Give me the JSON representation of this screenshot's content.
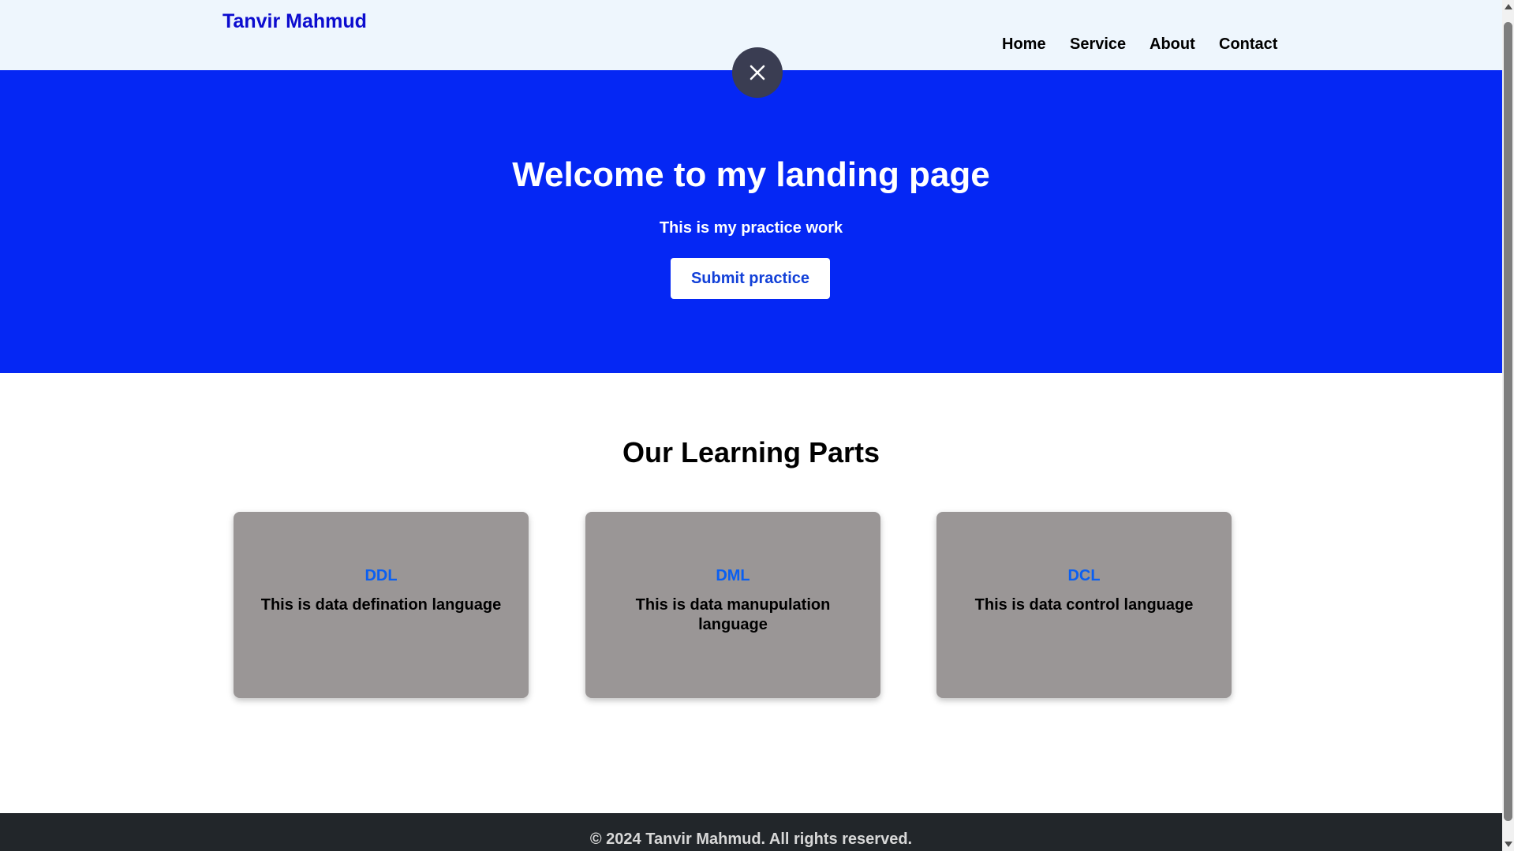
{
  "header": {
    "brand": "Tanvir Mahmud",
    "nav": {
      "home": "Home",
      "service": "Service",
      "about": "About",
      "contact": "Contact"
    }
  },
  "overlay": {
    "close_icon": "close-icon"
  },
  "hero": {
    "title": "Welcome to my landing page",
    "subtitle": "This is my practice work",
    "button_label": "Submit practice"
  },
  "learning": {
    "title": "Our Learning Parts",
    "cards": [
      {
        "title": "DDL",
        "text": "This is data defination language"
      },
      {
        "title": "DML",
        "text": "This is data manupulation language"
      },
      {
        "title": "DCL",
        "text": "This is data control language"
      }
    ]
  },
  "footer": {
    "text": "© 2024 Tanvir Mahmud. All rights reserved."
  },
  "colors": {
    "brand": "#0c0ccf",
    "hero_bg": "#0527f4",
    "card_bg": "#9a9696",
    "card_title": "#0a5ff2",
    "footer_bg": "#22262a",
    "navbar_bg": "#eef6fd"
  }
}
